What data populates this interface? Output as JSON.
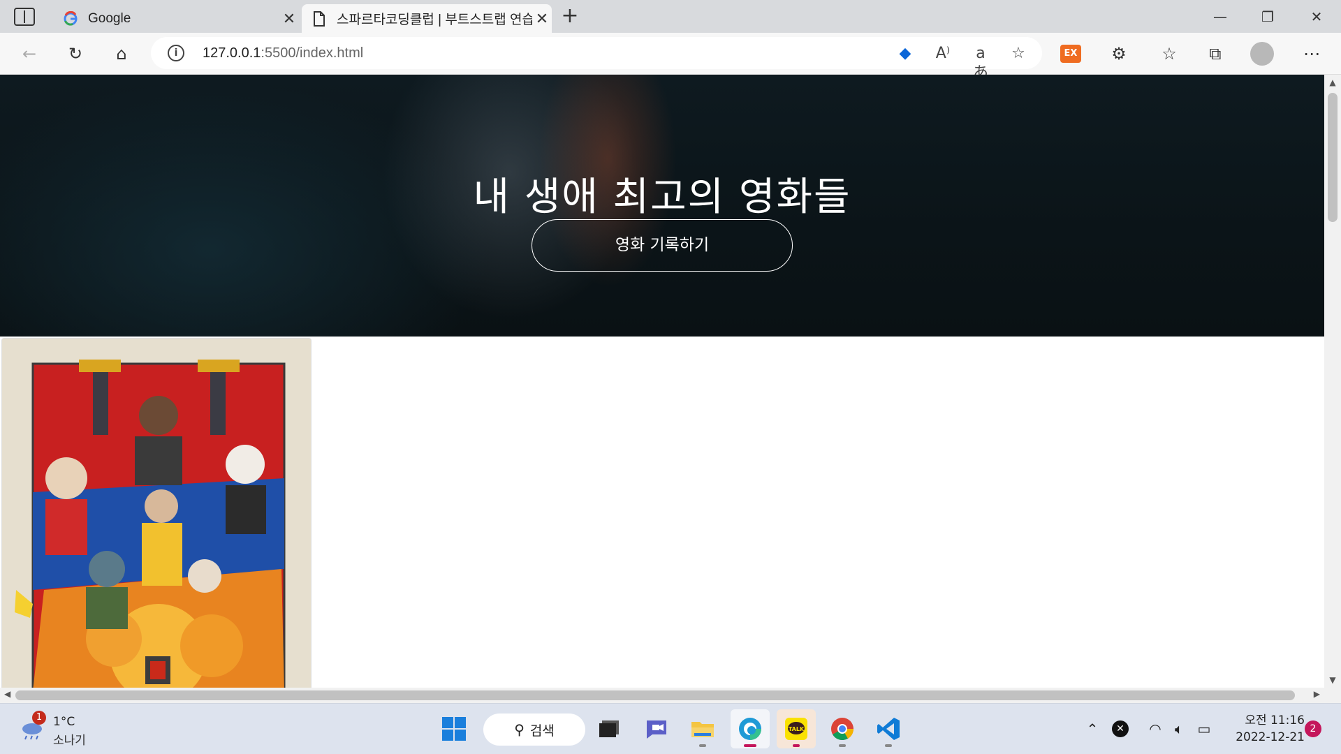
{
  "browser": {
    "tabs": [
      {
        "title": "Google",
        "active": false
      },
      {
        "title": "스파르타코딩클럽 | 부트스트랩 연습하기",
        "active": true
      }
    ],
    "address": {
      "host": "127.0.0.1",
      "rest": ":5500/index.html"
    },
    "window_buttons": {
      "minimize": "—",
      "restore": "❐",
      "close": "✕"
    }
  },
  "page": {
    "hero_title": "내 생애 최고의 영화들",
    "hero_button": "영화 기록하기"
  },
  "taskbar": {
    "weather": {
      "temp": "1°C",
      "desc": "소나기",
      "badge": "1"
    },
    "search_label": "검색",
    "clock_time": "오전 11:16",
    "clock_date": "2022-12-21",
    "notification_count": "2"
  }
}
